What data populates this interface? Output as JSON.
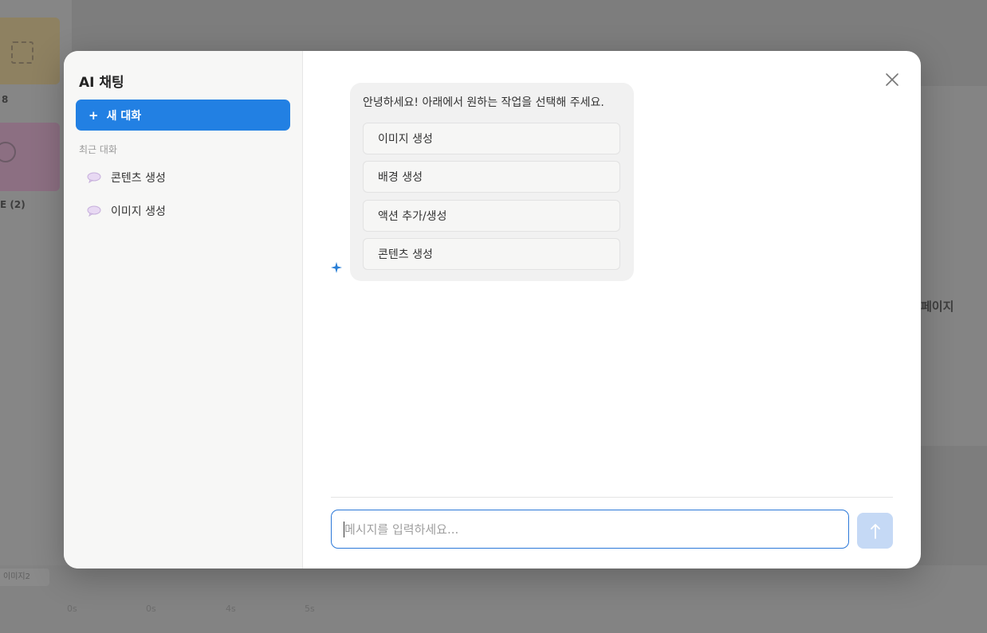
{
  "background": {
    "left_labels": [
      "8",
      "E (2)"
    ],
    "right_text": "페이지",
    "bottom_chip": "이미지2",
    "ticks": [
      "0s",
      "0s",
      "4s",
      "5s"
    ]
  },
  "sidebar": {
    "title": "AI 채팅",
    "new_chat_label": "새 대화",
    "recent_label": "최근 대화",
    "items": [
      {
        "label": "콘텐츠 생성",
        "icon": "chat-bubble-icon"
      },
      {
        "label": "이미지 생성",
        "icon": "chat-bubble-icon"
      }
    ]
  },
  "chat": {
    "greeting": "안녕하세요! 아래에서 원하는 작업을 선택해 주세요.",
    "options": [
      "이미지 생성",
      "배경 생성",
      "액션 추가/생성",
      "콘텐츠 생성"
    ]
  },
  "input": {
    "placeholder": "메시지를 입력하세요...",
    "value": ""
  },
  "colors": {
    "accent": "#2280e3",
    "send_disabled": "#c5d9f5",
    "input_border": "#2b78d8"
  },
  "icons": {
    "close": "close-icon",
    "assistant": "sparkle-icon",
    "send": "arrow-up-icon"
  }
}
